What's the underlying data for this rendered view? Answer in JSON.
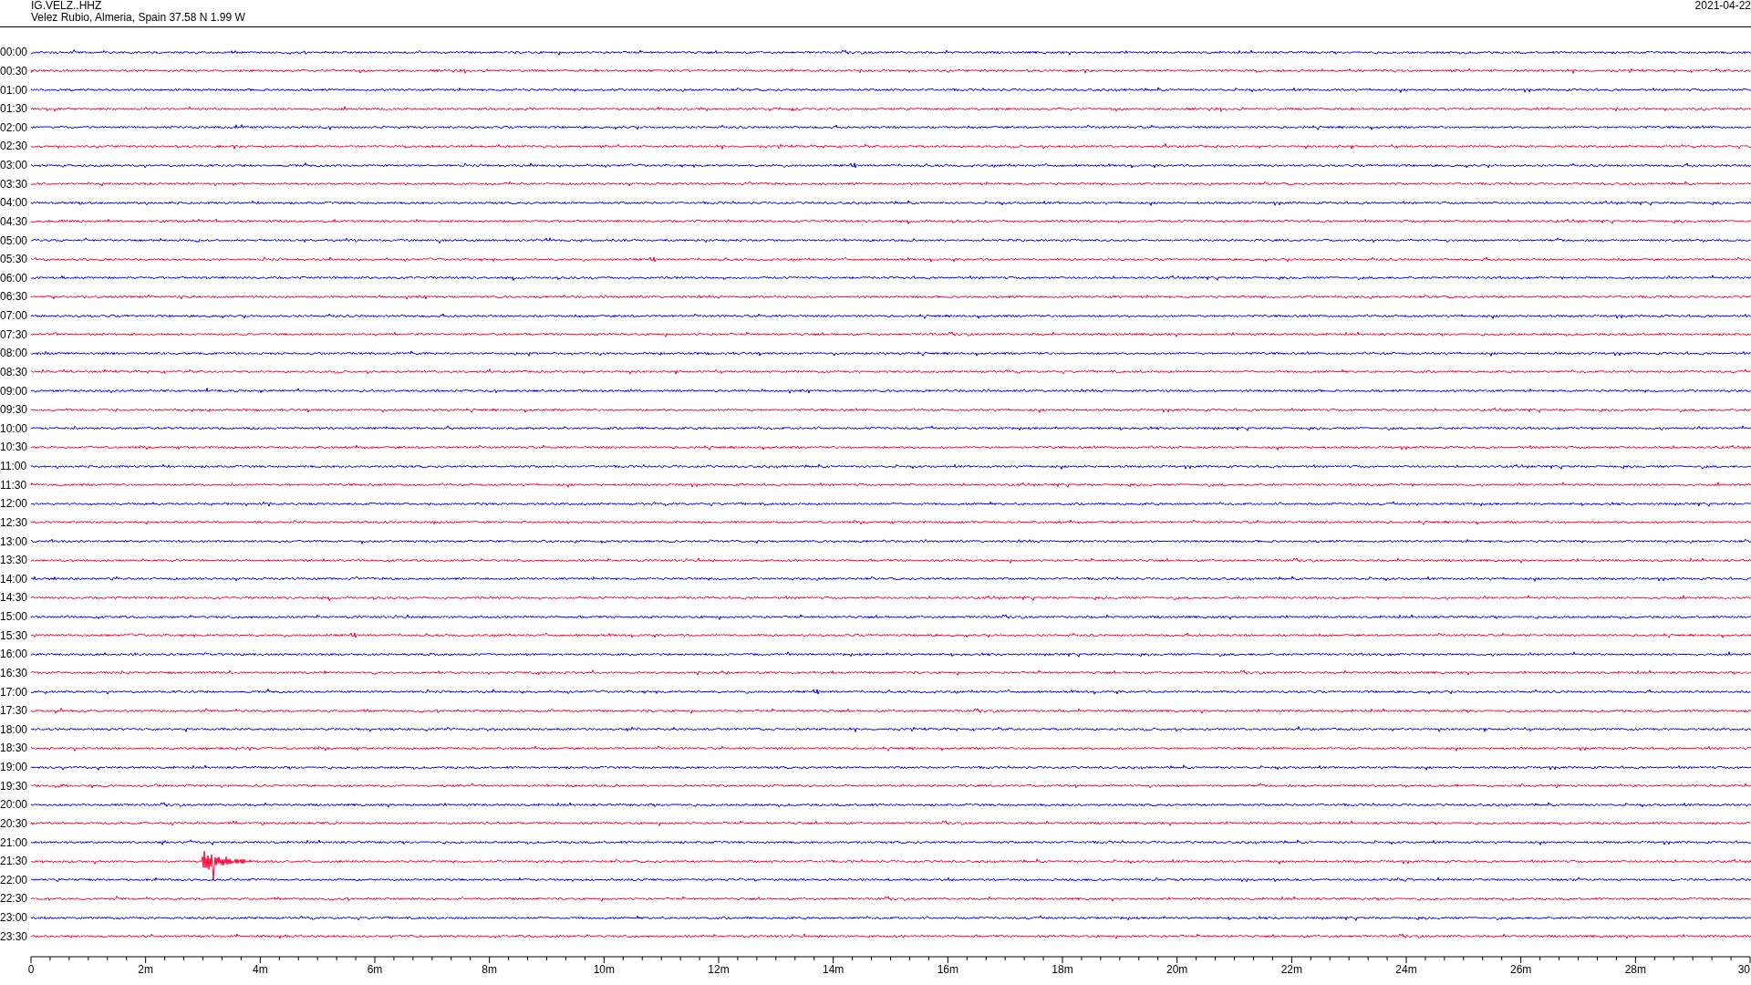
{
  "header": {
    "station": "IG.VELZ..HHZ",
    "location": "Velez Rubio, Almeria, Spain  37.58 N 1.99 W",
    "date": "2021-04-22"
  },
  "traces": [
    {
      "label": "00:00",
      "color": "#0000ff",
      "event": false
    },
    {
      "label": "00:30",
      "color": "#ff0033",
      "event": false
    },
    {
      "label": "01:00",
      "color": "#0000ff",
      "event": false
    },
    {
      "label": "01:30",
      "color": "#ff0033",
      "event": false
    },
    {
      "label": "02:00",
      "color": "#0000ff",
      "event": false
    },
    {
      "label": "02:30",
      "color": "#ff0033",
      "event": false
    },
    {
      "label": "03:00",
      "color": "#0000ff",
      "event": false
    },
    {
      "label": "03:30",
      "color": "#ff0033",
      "event": false
    },
    {
      "label": "04:00",
      "color": "#0000ff",
      "event": false
    },
    {
      "label": "04:30",
      "color": "#ff0033",
      "event": false
    },
    {
      "label": "05:00",
      "color": "#0000ff",
      "event": false
    },
    {
      "label": "05:30",
      "color": "#ff0033",
      "event": false
    },
    {
      "label": "06:00",
      "color": "#0000ff",
      "event": false
    },
    {
      "label": "06:30",
      "color": "#ff0033",
      "event": false
    },
    {
      "label": "07:00",
      "color": "#0000ff",
      "event": false
    },
    {
      "label": "07:30",
      "color": "#ff0033",
      "event": false
    },
    {
      "label": "08:00",
      "color": "#0000ff",
      "event": false
    },
    {
      "label": "08:30",
      "color": "#ff0033",
      "event": false
    },
    {
      "label": "09:00",
      "color": "#0000ff",
      "event": false
    },
    {
      "label": "09:30",
      "color": "#ff0033",
      "event": false
    },
    {
      "label": "10:00",
      "color": "#0000ff",
      "event": false
    },
    {
      "label": "10:30",
      "color": "#ff0033",
      "event": false
    },
    {
      "label": "11:00",
      "color": "#0000ff",
      "event": false
    },
    {
      "label": "11:30",
      "color": "#ff0033",
      "event": false
    },
    {
      "label": "12:00",
      "color": "#0000ff",
      "event": false
    },
    {
      "label": "12:30",
      "color": "#ff0033",
      "event": false
    },
    {
      "label": "13:00",
      "color": "#0000ff",
      "event": false
    },
    {
      "label": "13:30",
      "color": "#ff0033",
      "event": false
    },
    {
      "label": "14:00",
      "color": "#0000ff",
      "event": false
    },
    {
      "label": "14:30",
      "color": "#ff0033",
      "event": false
    },
    {
      "label": "15:00",
      "color": "#0000ff",
      "event": false
    },
    {
      "label": "15:30",
      "color": "#ff0033",
      "event": false
    },
    {
      "label": "16:00",
      "color": "#0000ff",
      "event": false
    },
    {
      "label": "16:30",
      "color": "#ff0033",
      "event": false
    },
    {
      "label": "17:00",
      "color": "#0000ff",
      "event": false
    },
    {
      "label": "17:30",
      "color": "#ff0033",
      "event": false
    },
    {
      "label": "18:00",
      "color": "#0000ff",
      "event": false
    },
    {
      "label": "18:30",
      "color": "#ff0033",
      "event": false
    },
    {
      "label": "19:00",
      "color": "#0000ff",
      "event": false
    },
    {
      "label": "19:30",
      "color": "#ff0033",
      "event": false
    },
    {
      "label": "20:00",
      "color": "#0000ff",
      "event": false
    },
    {
      "label": "20:30",
      "color": "#ff0033",
      "event": false
    },
    {
      "label": "21:00",
      "color": "#0000ff",
      "event": false
    },
    {
      "label": "21:30",
      "color": "#ff0033",
      "event": true
    },
    {
      "label": "22:00",
      "color": "#0000ff",
      "event": false
    },
    {
      "label": "22:30",
      "color": "#ff0033",
      "event": false
    },
    {
      "label": "23:00",
      "color": "#0000ff",
      "event": false
    },
    {
      "label": "23:30",
      "color": "#ff0033",
      "event": false
    }
  ],
  "axis": {
    "ticks": [
      "0",
      "2m",
      "4m",
      "6m",
      "8m",
      "10m",
      "12m",
      "14m",
      "16m",
      "18m",
      "20m",
      "22m",
      "24m",
      "26m",
      "28m",
      "30"
    ]
  }
}
